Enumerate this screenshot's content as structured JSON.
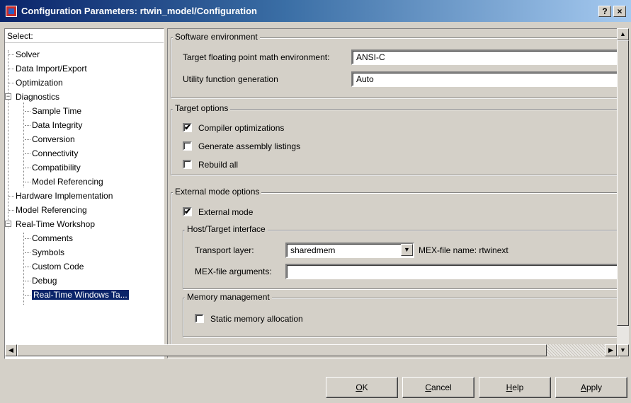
{
  "window": {
    "title": "Configuration Parameters: rtwin_model/Configuration",
    "help_btn": "?",
    "close_btn": "×"
  },
  "tree": {
    "header": "Select:",
    "items": [
      {
        "label": "Solver"
      },
      {
        "label": "Data Import/Export"
      },
      {
        "label": "Optimization"
      },
      {
        "label": "Diagnostics"
      },
      {
        "label": "Sample Time"
      },
      {
        "label": "Data Integrity"
      },
      {
        "label": "Conversion"
      },
      {
        "label": "Connectivity"
      },
      {
        "label": "Compatibility"
      },
      {
        "label": "Model Referencing"
      },
      {
        "label": "Hardware Implementation"
      },
      {
        "label": "Model Referencing"
      },
      {
        "label": "Real-Time Workshop"
      },
      {
        "label": "Comments"
      },
      {
        "label": "Symbols"
      },
      {
        "label": "Custom Code"
      },
      {
        "label": "Debug"
      },
      {
        "label": "Real-Time Windows Ta..."
      }
    ],
    "expand_symbol": "−"
  },
  "software_env": {
    "legend": "Software environment",
    "math_env_label": "Target floating point math environment:",
    "math_env_value": "ANSI-C",
    "utility_label": "Utility function generation",
    "utility_value": "Auto"
  },
  "target_options": {
    "legend": "Target options",
    "compiler_opt": {
      "label": "Compiler optimizations",
      "checked": "✔"
    },
    "assembly": {
      "label": "Generate assembly listings",
      "checked": ""
    },
    "rebuild": {
      "label": "Rebuild all",
      "checked": ""
    }
  },
  "external_mode": {
    "legend": "External mode options",
    "external_mode": {
      "label": "External mode",
      "checked": "✔"
    },
    "host_target": {
      "legend": "Host/Target interface",
      "transport_label": "Transport layer:",
      "transport_value": "sharedmem",
      "mex_name_label": "MEX-file name:",
      "mex_name_value": "rtwinext",
      "mex_args_label": "MEX-file arguments:",
      "mex_args_value": ""
    },
    "memory": {
      "legend": "Memory management",
      "static_alloc": {
        "label": "Static memory allocation",
        "checked": ""
      }
    }
  },
  "scroll": {
    "up": "▲",
    "down": "▼",
    "left": "◀",
    "right": "▶",
    "dropdown": "▼"
  },
  "buttons": {
    "ok": {
      "first": "O",
      "rest": "K"
    },
    "cancel": {
      "first": "C",
      "rest": "ancel"
    },
    "help": {
      "first": "H",
      "rest": "elp"
    },
    "apply": {
      "first": "A",
      "rest": "pply"
    }
  }
}
